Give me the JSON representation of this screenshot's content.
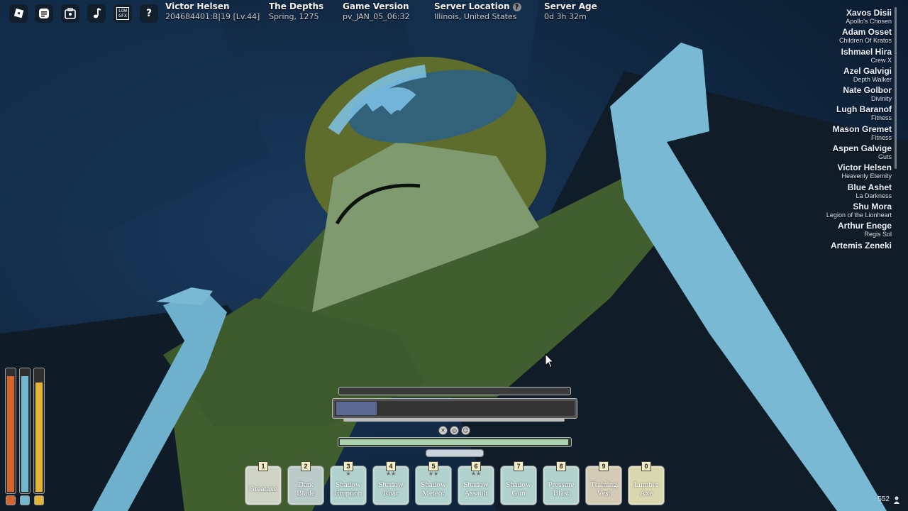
{
  "topbar": {
    "icons": [
      "roblox-menu-icon",
      "chat-icon",
      "backpack-icon",
      "music-icon",
      "graphics-icon",
      "help-icon"
    ],
    "graphics_label_top": "LOW",
    "graphics_label_bottom": "GFX",
    "help_glyph": "?"
  },
  "info": {
    "player": {
      "name": "Victor Helsen",
      "id": "204684401:B|19 [Lv.44]"
    },
    "location": {
      "label": "The Depths",
      "value": "Spring, 1275"
    },
    "version": {
      "label": "Game Version",
      "value": "pv_JAN_05_06:32"
    },
    "server_location": {
      "label": "Server Location",
      "value": "Illinois, United States",
      "help": "?"
    },
    "server_age": {
      "label": "Server Age",
      "value": "0d 3h 32m"
    }
  },
  "players": [
    {
      "name": "Xavos Disii",
      "subtitle": "Apollo's Chosen"
    },
    {
      "name": "Adam Osset",
      "subtitle": "Children Of Kratos"
    },
    {
      "name": "Ishmael Hira",
      "subtitle": "Crew X"
    },
    {
      "name": "Azel Galvigi",
      "subtitle": "Depth Walker"
    },
    {
      "name": "Nate Golbor",
      "subtitle": "Divinity"
    },
    {
      "name": "Lugh Baranof",
      "subtitle": "Fitness"
    },
    {
      "name": "Mason Gremet",
      "subtitle": "Fitness"
    },
    {
      "name": "Aspen Galvige",
      "subtitle": "Guts"
    },
    {
      "name": "Victor Helsen",
      "subtitle": "Heavenly Eternity"
    },
    {
      "name": "Blue Ashet",
      "subtitle": "La Darkness"
    },
    {
      "name": "Shu Mora",
      "subtitle": "Legion of the Lionheart"
    },
    {
      "name": "Arthur Enege",
      "subtitle": "Regis Sol"
    },
    {
      "name": "Artemis Zeneki",
      "subtitle": ""
    }
  ],
  "vitals": [
    {
      "name": "health",
      "color": "#d3652d",
      "level": 0.95
    },
    {
      "name": "ether",
      "color": "#6fb8cf",
      "level": 0.95
    },
    {
      "name": "stamina",
      "color": "#e3b437",
      "level": 0.9
    }
  ],
  "bars": {
    "posture_level": 0,
    "main_level": 0.17,
    "main_color": "#5c6a93",
    "tempo_level": 1,
    "tempo_color": "#a9d2ad",
    "status_icons": [
      "cross-status-icon",
      "swirl-status-icon",
      "face-status-icon"
    ]
  },
  "hotbar": [
    {
      "key": "1",
      "label": "Greataxe",
      "stars": "",
      "color": "#cfd3c6"
    },
    {
      "key": "2",
      "label": "Dark Blade",
      "stars": "",
      "color": "#b9ccc8"
    },
    {
      "key": "3",
      "label": "Shadow Eruption",
      "stars": "★",
      "color": "#b2d2cd"
    },
    {
      "key": "4",
      "label": "Shadow Roar",
      "stars": "★★",
      "color": "#b2d2cd"
    },
    {
      "key": "5",
      "label": "Shadow Meteor",
      "stars": "★★",
      "color": "#b2d2cd"
    },
    {
      "key": "6",
      "label": "Shadow Assault",
      "stars": "★★",
      "color": "#b2d2cd"
    },
    {
      "key": "7",
      "label": "Shadow Gun",
      "stars": "",
      "color": "#b2d2cd"
    },
    {
      "key": "8",
      "label": "Pressure Blast",
      "stars": "",
      "color": "#b2d2cd"
    },
    {
      "key": "9",
      "label": "Training Vest",
      "stars": "",
      "color": "#d4cbb7"
    },
    {
      "key": "0",
      "label": "Lumber Axe",
      "stars": "",
      "color": "#d9d7b0"
    }
  ],
  "fps": "552"
}
